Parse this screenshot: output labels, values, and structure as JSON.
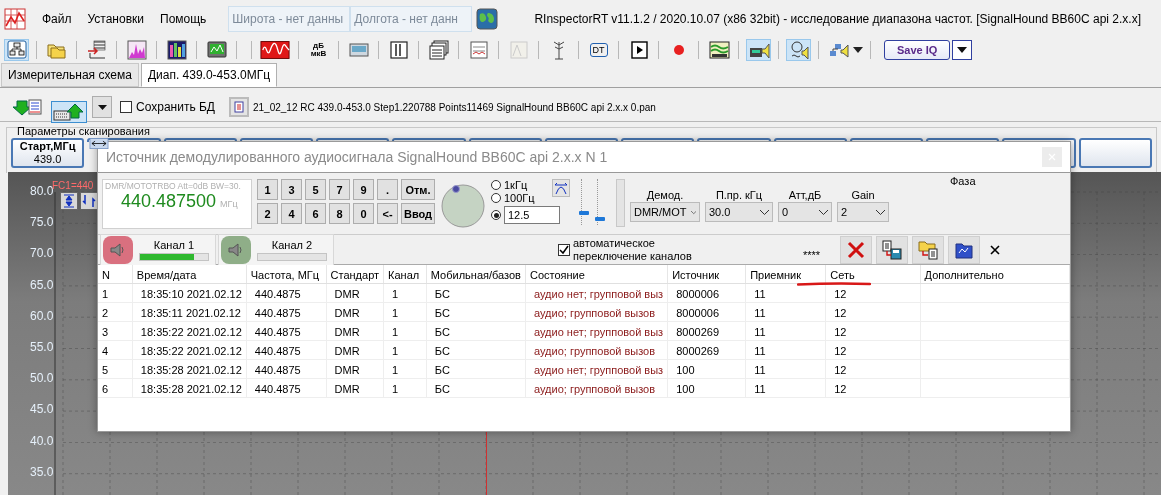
{
  "window": {
    "title": "RInspectorRT v11.1.2 / 2020.10.07 (x86 32bit) - исследование диапазона частот. [SignalHound BB60C api 2.x.x]"
  },
  "menu": [
    "Файл",
    "Установки",
    "Помощь"
  ],
  "location_fields": [
    {
      "placeholder": "Широта - нет данны"
    },
    {
      "placeholder": "Долгота - нет данн"
    }
  ],
  "toolbar": [
    {
      "kind": "icon",
      "pressed": true,
      "disabled": false
    },
    {
      "kind": "icon",
      "pressed": false,
      "disabled": false
    },
    {
      "kind": "icon",
      "pressed": false,
      "disabled": false
    },
    {
      "kind": "icon",
      "pressed": false,
      "disabled": false
    },
    {
      "kind": "icon",
      "pressed": false,
      "disabled": false
    },
    {
      "kind": "icon",
      "pressed": false,
      "disabled": false
    },
    {
      "kind": "icon",
      "pressed": false,
      "disabled": false
    },
    {
      "kind": "text",
      "label": "дБ мкВ",
      "pressed": false,
      "disabled": false
    },
    {
      "kind": "icon",
      "pressed": false,
      "disabled": false
    },
    {
      "kind": "icon",
      "pressed": false,
      "disabled": false
    },
    {
      "kind": "icon",
      "pressed": false,
      "disabled": false
    },
    {
      "kind": "icon",
      "pressed": false,
      "disabled": false
    },
    {
      "kind": "icon",
      "pressed": false,
      "disabled": true
    },
    {
      "kind": "icon",
      "pressed": false,
      "disabled": false
    },
    {
      "kind": "text",
      "label": "DT",
      "pressed": false,
      "disabled": false
    },
    {
      "kind": "icon",
      "pressed": false,
      "disabled": false
    },
    {
      "kind": "icon",
      "pressed": false,
      "disabled": false
    },
    {
      "kind": "icon",
      "pressed": false,
      "disabled": false
    },
    {
      "kind": "icon",
      "pressed": true,
      "disabled": false
    },
    {
      "kind": "icon",
      "pressed": true,
      "disabled": false
    },
    {
      "kind": "icon",
      "pressed": false,
      "disabled": false
    }
  ],
  "save_iq_button": {
    "label": "Save IQ"
  },
  "tabs": [
    {
      "label": "Измерительная схема",
      "selected": false
    },
    {
      "label": "Диап. 439.0-453.0МГц",
      "selected": true
    }
  ],
  "file_bar": {
    "save_db": {
      "label": "Сохранить БД",
      "checked": false
    },
    "file_name": "21_02_12 RC 439.0-453.0 Step1.220788 Points11469 SignalHound BB60C api 2.x.x 0.pan"
  },
  "scan_params": {
    "title": "Параметры сканирования",
    "start_button": {
      "label": "Старт,МГц",
      "value": "439.0"
    }
  },
  "spectrum": {
    "marker_label": "FC1=440",
    "y_labels": [
      "80.0",
      "75.0",
      "70.0",
      "65.0",
      "60.0",
      "55.0",
      "50.0",
      "45.0",
      "40.0",
      "35.0"
    ]
  },
  "dialog": {
    "title": "Источник демодулированного аудиосигнала SignalHound BB60C api 2.x.x N 1",
    "frequency": {
      "info": "DMR/MOTOTRBO Att=0dB BW=30.",
      "value": "440.487500",
      "unit": "МГц"
    },
    "keypad": [
      [
        "1",
        "3",
        "5",
        "7",
        "9",
        ".",
        "Отм."
      ],
      [
        "2",
        "4",
        "6",
        "8",
        "0",
        "<-",
        "Ввод"
      ]
    ],
    "step": {
      "options": [
        {
          "label": "1кГц",
          "selected": false
        },
        {
          "label": "100Гц",
          "selected": false
        },
        {
          "selected": true
        }
      ],
      "value": "12.5"
    },
    "sliders": [
      {
        "level": 0.25
      },
      {
        "level": 0.1
      }
    ],
    "selects": [
      {
        "label": "Демод.",
        "value": "DMR/MOT"
      },
      {
        "label": "П.пр. кГц",
        "value": "30.0"
      },
      {
        "label": "Атт,дБ",
        "value": "0"
      },
      {
        "label": "Gain",
        "value": "2"
      }
    ],
    "phase_label": "Фаза",
    "channels": [
      {
        "label": "Канал 1",
        "color": "#d9707f",
        "level": 0.8
      },
      {
        "label": "Канал 2",
        "color": "#8fae88",
        "level": 0
      }
    ],
    "auto_switch": {
      "label": "автоматическое переключение каналов",
      "checked": true
    },
    "indicator": "****",
    "table": {
      "columns": [
        {
          "label": "N",
          "underlined": false
        },
        {
          "label": "Время/дата",
          "underlined": false
        },
        {
          "label": "Частота, МГц",
          "underlined": false
        },
        {
          "label": "Стандарт",
          "underlined": false
        },
        {
          "label": "Канал",
          "underlined": false
        },
        {
          "label": "Мобильная/базов",
          "underlined": false
        },
        {
          "label": "Состояние",
          "underlined": false,
          "color": "#8b1a1a"
        },
        {
          "label": "Источник",
          "underlined": false
        },
        {
          "label": "Приемник",
          "underlined": false
        },
        {
          "label": "Сеть",
          "underlined": true
        },
        {
          "label": "Дополнительно",
          "underlined": false
        }
      ],
      "rows": [
        [
          "1",
          "18:35:10 2021.02.12",
          "440.4875",
          "DMR",
          "1",
          "БС",
          "аудио нет; групповой выз",
          "8000006",
          "11",
          "12",
          ""
        ],
        [
          "2",
          "18:35:11 2021.02.12",
          "440.4875",
          "DMR",
          "1",
          "БС",
          "аудио; групповой вызов",
          "8000006",
          "11",
          "12",
          ""
        ],
        [
          "3",
          "18:35:22 2021.02.12",
          "440.4875",
          "DMR",
          "1",
          "БС",
          "аудио нет; групповой выз",
          "8000269",
          "11",
          "12",
          ""
        ],
        [
          "4",
          "18:35:22 2021.02.12",
          "440.4875",
          "DMR",
          "1",
          "БС",
          "аудио; групповой вызов",
          "8000269",
          "11",
          "12",
          ""
        ],
        [
          "5",
          "18:35:28 2021.02.12",
          "440.4875",
          "DMR",
          "1",
          "БС",
          "аудио нет; групповой выз",
          "100",
          "11",
          "12",
          ""
        ],
        [
          "6",
          "18:35:28 2021.02.12",
          "440.4875",
          "DMR",
          "1",
          "БС",
          "аудио; групповой вызов",
          "100",
          "11",
          "12",
          ""
        ]
      ]
    }
  }
}
